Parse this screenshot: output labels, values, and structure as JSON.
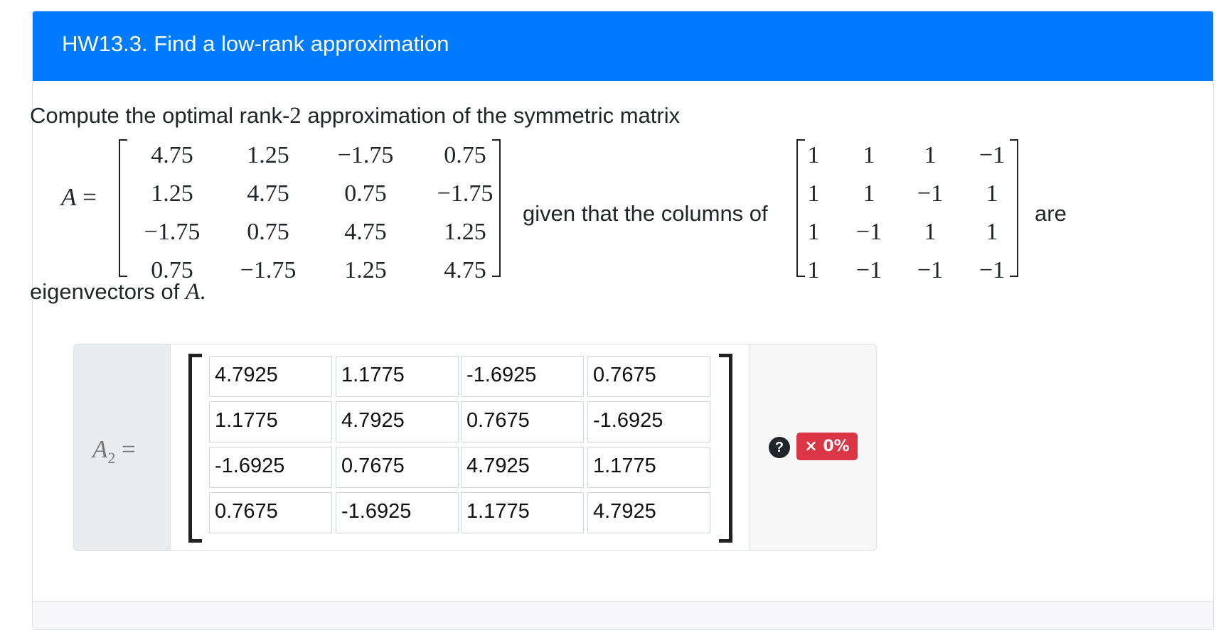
{
  "question": {
    "title": "HW13.3. Find a low-rank approximation",
    "intro_text": "Compute the optimal rank-",
    "rank_value": "2",
    "intro_text_2": " approximation of the symmetric matrix",
    "matrix_symbol": "A",
    "equals": "=",
    "matrix_A": [
      [
        "4.75",
        "1.25",
        "−1.75",
        "0.75"
      ],
      [
        "1.25",
        "4.75",
        "0.75",
        "−1.75"
      ],
      [
        "−1.75",
        "0.75",
        "4.75",
        "1.25"
      ],
      [
        "0.75",
        "−1.75",
        "1.25",
        "4.75"
      ]
    ],
    "middle_text": "given that the columns of",
    "eigvec_matrix": [
      [
        "1",
        "1",
        "1",
        "−1"
      ],
      [
        "1",
        "1",
        "−1",
        "1"
      ],
      [
        "1",
        "−1",
        "1",
        "1"
      ],
      [
        "1",
        "−1",
        "−1",
        "−1"
      ]
    ],
    "end_text": "are",
    "last_line_text": "eigenvectors of ",
    "last_line_symbol": "A",
    "last_line_period": "."
  },
  "answer": {
    "label_symbol": "A",
    "label_subscript": "2",
    "label_equals": "=",
    "inputs": [
      [
        "4.7925",
        "1.1775",
        "-1.6925",
        "0.7675"
      ],
      [
        "1.1775",
        "4.7925",
        "0.7675",
        "-1.6925"
      ],
      [
        "-1.6925",
        "0.7675",
        "4.7925",
        "1.1775"
      ],
      [
        "0.7675",
        "-1.6925",
        "1.1775",
        "4.7925"
      ]
    ],
    "help_icon": "?",
    "score_badge": "× 0%",
    "score_color": "#dc3545"
  },
  "colors": {
    "header": "#007bff"
  }
}
